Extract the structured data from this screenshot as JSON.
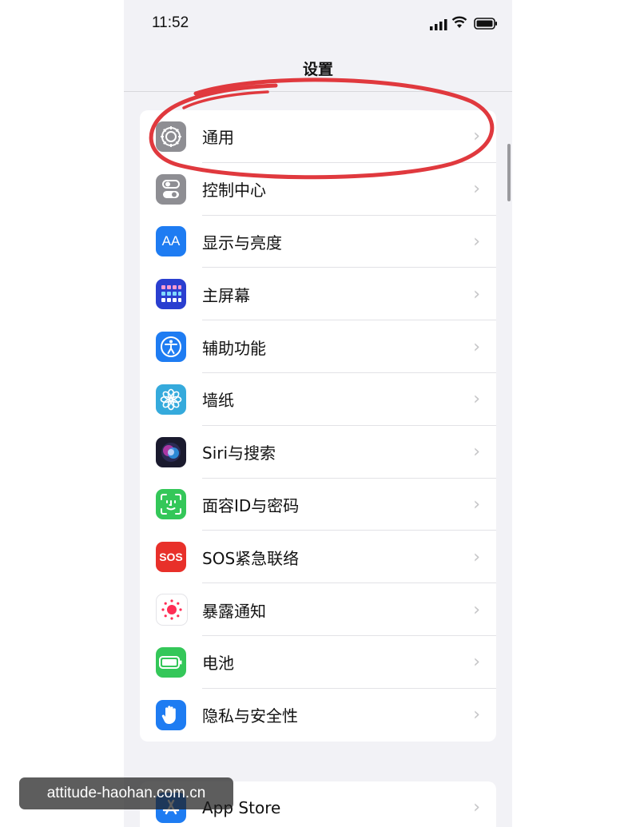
{
  "status_bar": {
    "time": "11:52"
  },
  "nav": {
    "title": "设置"
  },
  "settings": [
    {
      "label": "通用",
      "icon": "gear-icon",
      "color": "#8e8e93"
    },
    {
      "label": "控制中心",
      "icon": "toggles-icon",
      "color": "#8e8e93"
    },
    {
      "label": "显示与亮度",
      "icon": "text-size-icon",
      "color": "#1e7cf2",
      "glyph": "AA"
    },
    {
      "label": "主屏幕",
      "icon": "home-grid-icon",
      "color": "#2a3fd0"
    },
    {
      "label": "辅助功能",
      "icon": "accessibility-icon",
      "color": "#1e7cf2"
    },
    {
      "label": "墙纸",
      "icon": "flower-icon",
      "color": "#35aadc"
    },
    {
      "label": "Siri与搜索",
      "icon": "siri-icon",
      "color": "#1a1a2e"
    },
    {
      "label": "面容ID与密码",
      "icon": "face-id-icon",
      "color": "#34c759"
    },
    {
      "label": "SOS紧急联络",
      "icon": "sos-icon",
      "color": "#e8302a",
      "glyph": "SOS"
    },
    {
      "label": "暴露通知",
      "icon": "exposure-icon",
      "color": "#ffffff"
    },
    {
      "label": "电池",
      "icon": "battery-icon",
      "color": "#34c759"
    },
    {
      "label": "隐私与安全性",
      "icon": "hand-icon",
      "color": "#1e7cf2"
    }
  ],
  "store_group": {
    "label": "App Store",
    "icon": "app-store-icon",
    "color": "#1e7cf2"
  },
  "watermark": "attitude-haohan.com.cn",
  "annotation_color": "#e0393e"
}
